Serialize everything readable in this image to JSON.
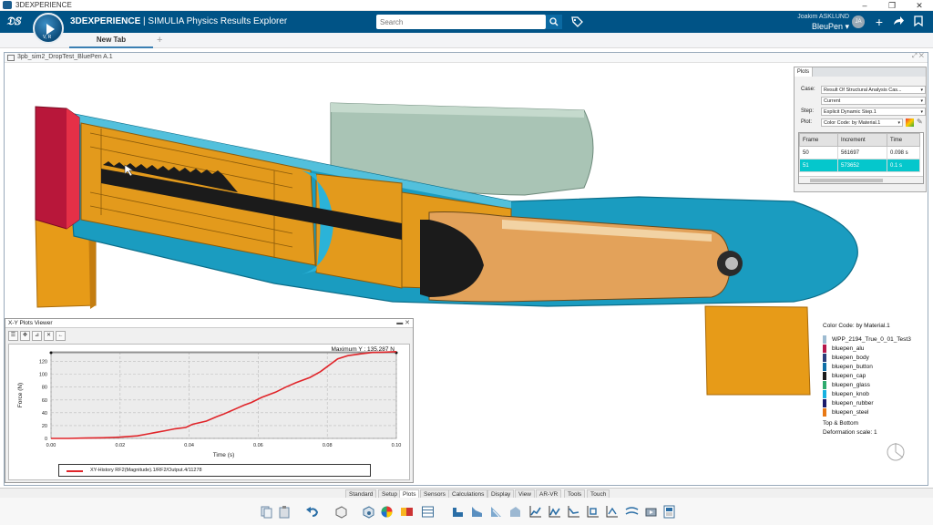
{
  "window": {
    "title": "3DEXPERIENCE"
  },
  "app": {
    "brand_bold": "3DEXPERIENCE",
    "brand_rest": " | SIMULIA Physics Results Explorer",
    "search_placeholder": "Search",
    "user_name": "Joakim ASKLUND",
    "workspace": "BleuPen",
    "avatar_initials": "JA",
    "compass_label": "V, R"
  },
  "tabs": {
    "active": "New Tab",
    "add": "+"
  },
  "viewer": {
    "title": "3pb_sim2_DropTest_BluePen A.1"
  },
  "plots_panel": {
    "tab": "Plots",
    "case_label": "Case:",
    "case_value": "Result Of Structural Analysis Cas...",
    "current_value": "Current",
    "step_label": "Step:",
    "step_value": "Explicit Dynamic Step.1",
    "plot_label": "Plot:",
    "plot_value": "Color Code: by Material.1",
    "columns": [
      "Frame",
      "Increment",
      "Time"
    ],
    "rows": [
      {
        "frame": "50",
        "increment": "561697",
        "time": "0.098 s"
      },
      {
        "frame": "51",
        "increment": "573652",
        "time": "0.1 s"
      }
    ]
  },
  "legend": {
    "title": "Color Code: by Material.1",
    "items": [
      {
        "label": "WPP_2194_True_0_01_Test3",
        "color": "#9dbbd1"
      },
      {
        "label": "bluepen_alu",
        "color": "#b5174a"
      },
      {
        "label": "bluepen_body",
        "color": "#2a3d7a"
      },
      {
        "label": "bluepen_button",
        "color": "#0e6fa7"
      },
      {
        "label": "bluepen_cap",
        "color": "#1b1b1b"
      },
      {
        "label": "bluepen_glass",
        "color": "#2eaa6e"
      },
      {
        "label": "bluepen_knob",
        "color": "#16b1e0"
      },
      {
        "label": "bluepen_rubber",
        "color": "#1a1a6a"
      },
      {
        "label": "bluepen_steel",
        "color": "#e87914"
      }
    ],
    "top_bottom": "Top & Bottom",
    "deformation": "Deformation scale: 1"
  },
  "xy_viewer": {
    "title": "X-Y Plots Viewer",
    "max_label": "Maximum Y : 135.287 N",
    "legend_entry": "XY-History RF2(Magnitude).1/RF2/Output.4/11278"
  },
  "chart_data": {
    "type": "line",
    "title": "",
    "xlabel": "Time (s)",
    "ylabel": "Force (N)",
    "xlim": [
      0,
      0.1
    ],
    "ylim": [
      0,
      135
    ],
    "xticks": [
      "0.00",
      "0.02",
      "0.04",
      "0.06",
      "0.08",
      "0.10"
    ],
    "yticks": [
      "0",
      "20",
      "40",
      "60",
      "80",
      "100",
      "120"
    ],
    "grid": true,
    "legend_position": "bottom",
    "series": [
      {
        "name": "XY-History RF2(Magnitude).1/RF2/Output.4/11278",
        "color": "#e0252a",
        "x": [
          0,
          0.005,
          0.01,
          0.015,
          0.02,
          0.025,
          0.028,
          0.03,
          0.033,
          0.036,
          0.039,
          0.041,
          0.045,
          0.048,
          0.05,
          0.053,
          0.056,
          0.058,
          0.061,
          0.065,
          0.068,
          0.071,
          0.075,
          0.078,
          0.08,
          0.083,
          0.086,
          0.09,
          0.093,
          0.096,
          0.1
        ],
        "y": [
          0,
          0,
          0.5,
          1,
          2,
          4,
          7,
          9,
          12,
          15,
          17,
          22,
          27,
          34,
          38,
          45,
          52,
          56,
          64,
          72,
          80,
          87,
          95,
          104,
          112,
          124,
          129,
          132,
          134,
          134.5,
          135.3
        ]
      }
    ]
  },
  "bottom_tabs": [
    "Standard",
    "Setup",
    "Plots",
    "Sensors",
    "Calculations",
    "Display",
    "View",
    "AR-VR",
    "Tools",
    "Touch"
  ],
  "bottom_tabs_active": "Plots"
}
